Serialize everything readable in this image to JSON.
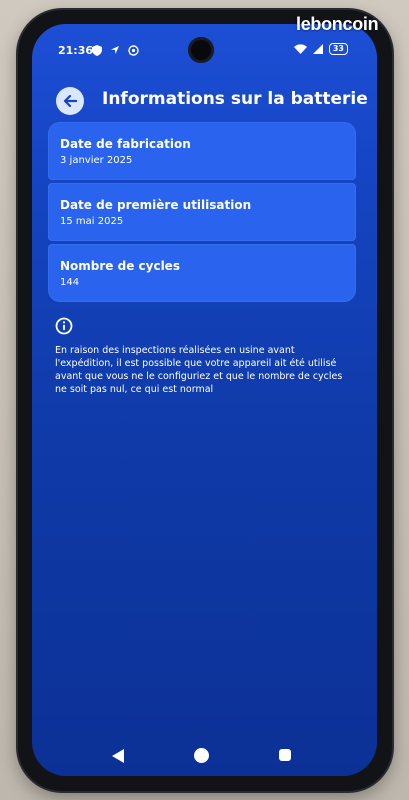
{
  "watermark": "leboncoin",
  "status_bar": {
    "time": "21:36",
    "battery_level": "33",
    "icons_left": [
      "shield-icon",
      "navigation-icon",
      "whatsapp-icon"
    ],
    "icons_right": [
      "wifi-icon",
      "signal-icon",
      "battery-icon"
    ]
  },
  "header": {
    "title": "Informations sur la batterie",
    "back_icon": "arrow-left-icon"
  },
  "cards": [
    {
      "label": "Date de fabrication",
      "value": "3 janvier 2025"
    },
    {
      "label": "Date de première utilisation",
      "value": "15 mai 2025"
    },
    {
      "label": "Nombre de cycles",
      "value": "144"
    }
  ],
  "info": {
    "icon": "info-icon",
    "text": "En raison des inspections réalisées en usine avant l'expédition, il est possible que votre appareil ait été utilisé avant que vous ne le configuriez et que le nombre de cycles ne soit pas nul, ce qui est normal"
  },
  "navbar": {
    "icons": [
      "back-triangle-icon",
      "home-circle-icon",
      "recents-square-icon"
    ]
  },
  "colors": {
    "screen_background": "#1545c2",
    "card_background": "#2a64ee",
    "back_button_background": "#dbe6ff"
  }
}
